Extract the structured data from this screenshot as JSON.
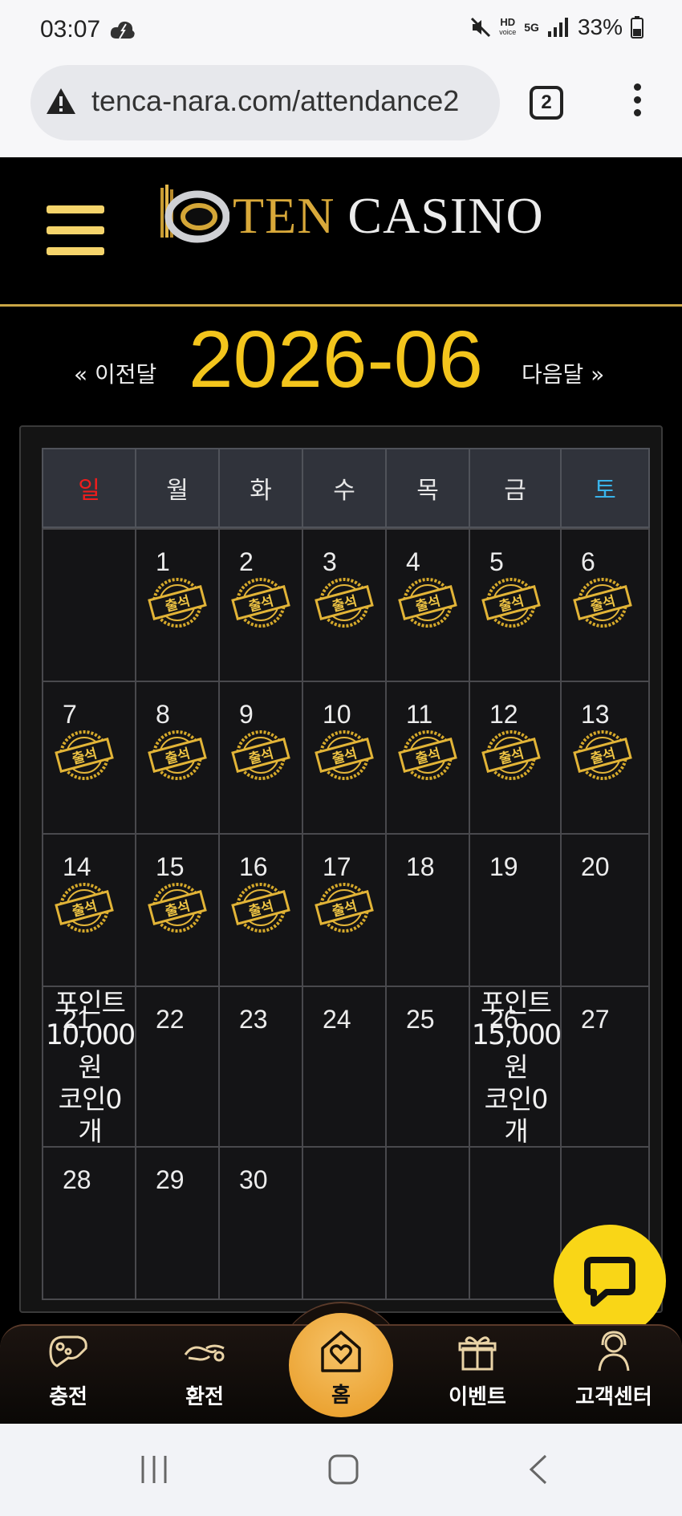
{
  "status_bar": {
    "time": "03:07",
    "battery": "33%",
    "hd_label": "HD",
    "voice_label": "voice",
    "network": "5G"
  },
  "browser": {
    "url": "tenca-nara.com/attendance2",
    "tab_count": "2"
  },
  "site": {
    "logo_ten": "TEN",
    "logo_casino": "CASINO"
  },
  "month_nav": {
    "prev": "« 이전달",
    "title": "2026-06",
    "next": "다음달 »"
  },
  "calendar": {
    "weekdays": [
      "일",
      "월",
      "화",
      "수",
      "목",
      "금",
      "토"
    ],
    "stamp_label": "출석",
    "weeks": [
      [
        {
          "day": ""
        },
        {
          "day": "1",
          "stamp": true
        },
        {
          "day": "2",
          "stamp": true
        },
        {
          "day": "3",
          "stamp": true
        },
        {
          "day": "4",
          "stamp": true
        },
        {
          "day": "5",
          "stamp": true
        },
        {
          "day": "6",
          "stamp": true
        }
      ],
      [
        {
          "day": "7",
          "stamp": true
        },
        {
          "day": "8",
          "stamp": true
        },
        {
          "day": "9",
          "stamp": true
        },
        {
          "day": "10",
          "stamp": true
        },
        {
          "day": "11",
          "stamp": true
        },
        {
          "day": "12",
          "stamp": true
        },
        {
          "day": "13",
          "stamp": true
        }
      ],
      [
        {
          "day": "14",
          "stamp": true
        },
        {
          "day": "15",
          "stamp": true
        },
        {
          "day": "16",
          "stamp": true
        },
        {
          "day": "17",
          "stamp": true
        },
        {
          "day": "18"
        },
        {
          "day": "19"
        },
        {
          "day": "20"
        }
      ],
      [
        {
          "day": "21",
          "reward": [
            "포인트",
            "10,000",
            "원",
            "코인0",
            "개"
          ]
        },
        {
          "day": "22"
        },
        {
          "day": "23"
        },
        {
          "day": "24"
        },
        {
          "day": "25"
        },
        {
          "day": "26",
          "reward": [
            "포인트",
            "15,000",
            "원",
            "코인0",
            "개"
          ]
        },
        {
          "day": "27"
        }
      ],
      [
        {
          "day": "28"
        },
        {
          "day": "29"
        },
        {
          "day": "30"
        },
        {
          "day": ""
        },
        {
          "day": ""
        },
        {
          "day": ""
        },
        {
          "day": ""
        }
      ]
    ]
  },
  "bottom_nav": {
    "charge": "충전",
    "exchange": "환전",
    "home": "홈",
    "event": "이벤트",
    "support": "고객센터"
  },
  "colors": {
    "gold": "#f3c51c",
    "sunday": "#ef1d1d",
    "saturday": "#39b3ea",
    "chat": "#f9d617"
  }
}
